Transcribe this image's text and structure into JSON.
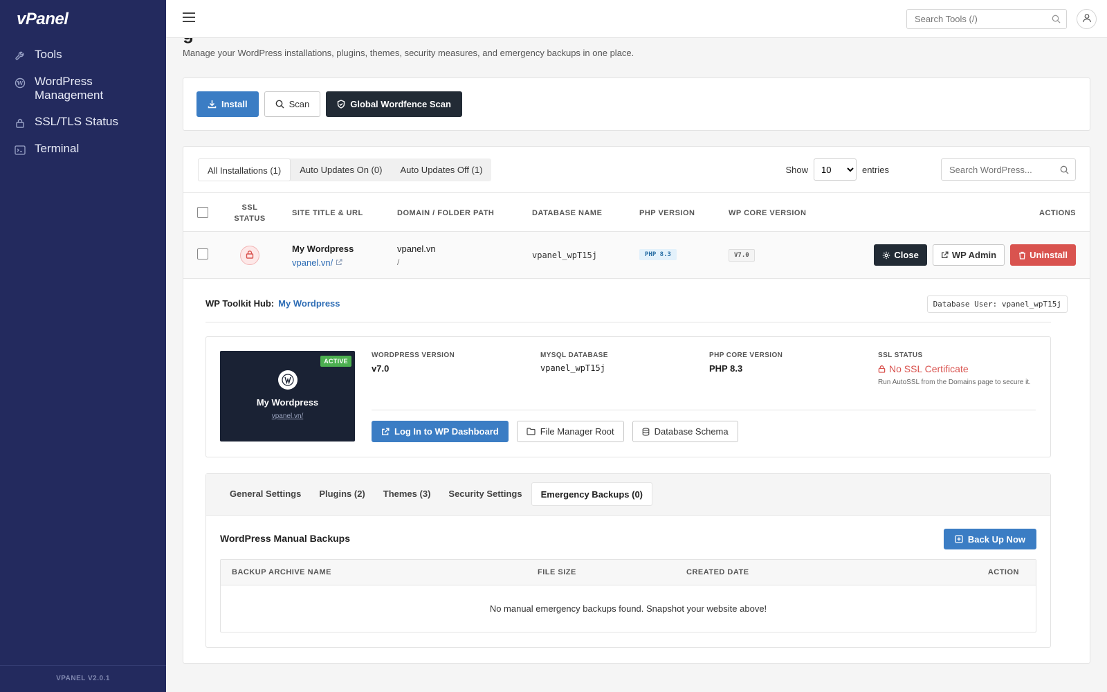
{
  "sidebar": {
    "logo": "vPanel",
    "items": [
      {
        "label": "Tools",
        "icon": "wrench-icon"
      },
      {
        "label": "WordPress Management",
        "icon": "wordpress-icon"
      },
      {
        "label": "SSL/TLS Status",
        "icon": "lock-icon"
      },
      {
        "label": "Terminal",
        "icon": "terminal-icon"
      }
    ],
    "version": "VPANEL V2.0.1"
  },
  "topbar": {
    "search_placeholder": "Search Tools (/)"
  },
  "page": {
    "title_partial": "g",
    "subtitle": "Manage your WordPress installations, plugins, themes, security measures, and emergency backups in one place."
  },
  "toolbar": {
    "install": "Install",
    "scan": "Scan",
    "global_scan": "Global Wordfence Scan"
  },
  "list": {
    "tabs": [
      "All Installations (1)",
      "Auto Updates On (0)",
      "Auto Updates Off (1)"
    ],
    "show_label": "Show",
    "entries_value": "10",
    "entries_label": "entries",
    "search_placeholder": "Search WordPress...",
    "columns": {
      "ssl_line1": "SSL",
      "ssl_line2": "STATUS",
      "site": "SITE TITLE & URL",
      "domain": "DOMAIN / FOLDER PATH",
      "db": "DATABASE NAME",
      "php": "PHP VERSION",
      "wp": "WP CORE VERSION",
      "actions": "ACTIONS"
    },
    "row": {
      "title": "My Wordpress",
      "url": "vpanel.vn/",
      "domain": "vpanel.vn",
      "path": "/",
      "db": "vpanel_wpT15j",
      "php": "PHP 8.3",
      "wp": "V7.0",
      "close": "Close",
      "wp_admin": "WP Admin",
      "uninstall": "Uninstall"
    }
  },
  "hub": {
    "label": "WP Toolkit Hub:",
    "site": "My Wordpress",
    "db_user": "Database User: vpanel_wpT15j",
    "preview": {
      "badge": "ACTIVE",
      "title": "My Wordpress",
      "url": "vpanel.vn/"
    },
    "info": {
      "wp_label": "WORDPRESS VERSION",
      "wp_value": "v7.0",
      "mysql_label": "MYSQL DATABASE",
      "mysql_value": "vpanel_wpT15j",
      "php_label": "PHP CORE VERSION",
      "php_value": "PHP 8.3",
      "ssl_label": "SSL STATUS",
      "ssl_value": "No SSL Certificate",
      "ssl_note": "Run AutoSSL from the Domains page to secure it."
    },
    "buttons": {
      "login": "Log In to WP Dashboard",
      "file_manager": "File Manager Root",
      "schema": "Database Schema"
    }
  },
  "detail_tabs": {
    "tabs": [
      "General Settings",
      "Plugins (2)",
      "Themes (3)",
      "Security Settings",
      "Emergency Backups (0)"
    ],
    "active_index": 4
  },
  "backups": {
    "title": "WordPress Manual Backups",
    "backup_now": "Back Up Now",
    "columns": [
      "BACKUP ARCHIVE NAME",
      "FILE SIZE",
      "CREATED DATE",
      "ACTION"
    ],
    "empty": "No manual emergency backups found. Snapshot your website above!"
  },
  "colors": {
    "sidebar_bg": "#232a5e",
    "primary": "#3b7dc4",
    "dark": "#222b35",
    "danger": "#d9534f",
    "active_badge": "#4caf50"
  }
}
